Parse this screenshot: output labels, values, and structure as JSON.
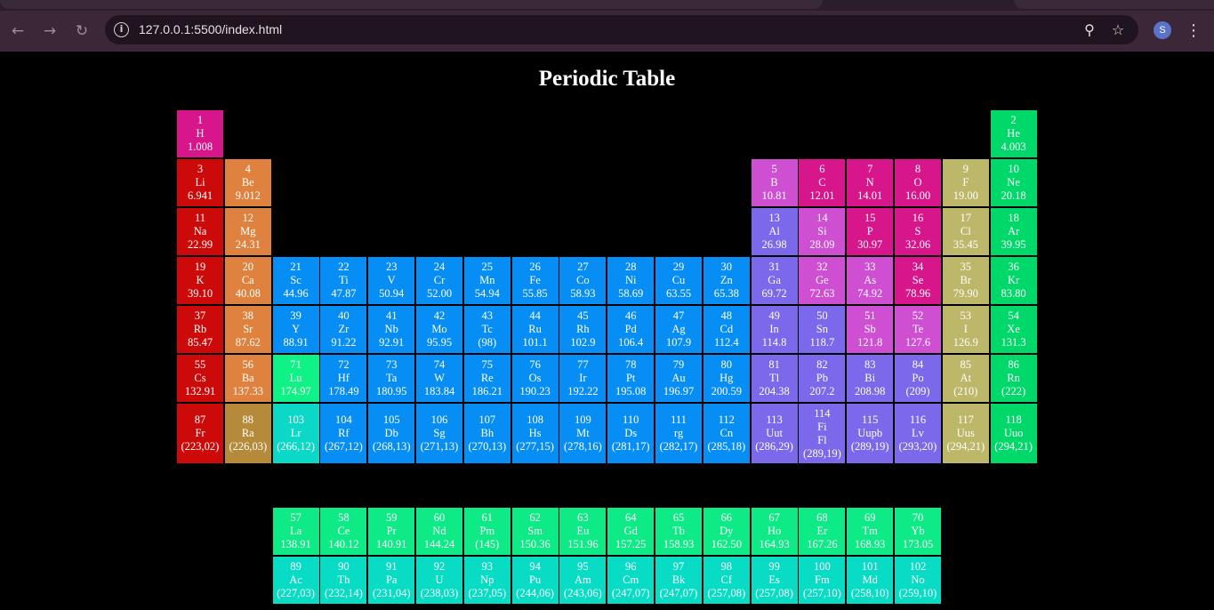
{
  "browser": {
    "url": "127.0.0.1:5500/index.html",
    "avatar_letter": "S",
    "icons": {
      "back": "back-arrow-icon",
      "forward": "forward-arrow-icon",
      "reload": "reload-icon",
      "site_info": "site-info-icon",
      "zoom": "zoom-icon",
      "bookmark": "bookmark-star-icon",
      "menu": "kebab-menu-icon"
    }
  },
  "page": {
    "title": "Periodic Table"
  },
  "colors": {
    "hydrogen": "#d6168a",
    "alkali": "#cc0a0a",
    "alkaline": "#df8240",
    "radium": "#b58a3a",
    "transition": "#078ef5",
    "lanthanide": "#0dea86",
    "actinide": "#08dcc4",
    "lutetium": "#0ff286",
    "lawrencium": "#0cd8c8",
    "post_transition": "#7b68ea",
    "metalloid": "#cf4fd3",
    "nonmetal": "#d6168a",
    "halogen": "#bdb769",
    "noble": "#00d86a"
  },
  "elements": [
    {
      "n": "1",
      "s": "H",
      "m": "1.008",
      "col": 1,
      "row": 1,
      "cat": "hydrogen"
    },
    {
      "n": "2",
      "s": "He",
      "m": "4.003",
      "col": 18,
      "row": 1,
      "cat": "noble"
    },
    {
      "n": "3",
      "s": "Li",
      "m": "6.941",
      "col": 1,
      "row": 2,
      "cat": "alkali"
    },
    {
      "n": "4",
      "s": "Be",
      "m": "9.012",
      "col": 2,
      "row": 2,
      "cat": "alkaline"
    },
    {
      "n": "5",
      "s": "B",
      "m": "10.81",
      "col": 13,
      "row": 2,
      "cat": "metalloid"
    },
    {
      "n": "6",
      "s": "C",
      "m": "12.01",
      "col": 14,
      "row": 2,
      "cat": "nonmetal"
    },
    {
      "n": "7",
      "s": "N",
      "m": "14.01",
      "col": 15,
      "row": 2,
      "cat": "nonmetal"
    },
    {
      "n": "8",
      "s": "O",
      "m": "16.00",
      "col": 16,
      "row": 2,
      "cat": "nonmetal"
    },
    {
      "n": "9",
      "s": "F",
      "m": "19.00",
      "col": 17,
      "row": 2,
      "cat": "halogen"
    },
    {
      "n": "10",
      "s": "Ne",
      "m": "20.18",
      "col": 18,
      "row": 2,
      "cat": "noble"
    },
    {
      "n": "11",
      "s": "Na",
      "m": "22.99",
      "col": 1,
      "row": 3,
      "cat": "alkali"
    },
    {
      "n": "12",
      "s": "Mg",
      "m": "24.31",
      "col": 2,
      "row": 3,
      "cat": "alkaline"
    },
    {
      "n": "13",
      "s": "Al",
      "m": "26.98",
      "col": 13,
      "row": 3,
      "cat": "post_transition"
    },
    {
      "n": "14",
      "s": "Si",
      "m": "28.09",
      "col": 14,
      "row": 3,
      "cat": "metalloid"
    },
    {
      "n": "15",
      "s": "P",
      "m": "30.97",
      "col": 15,
      "row": 3,
      "cat": "nonmetal"
    },
    {
      "n": "16",
      "s": "S",
      "m": "32.06",
      "col": 16,
      "row": 3,
      "cat": "nonmetal"
    },
    {
      "n": "17",
      "s": "Cl",
      "m": "35.45",
      "col": 17,
      "row": 3,
      "cat": "halogen"
    },
    {
      "n": "18",
      "s": "Ar",
      "m": "39.95",
      "col": 18,
      "row": 3,
      "cat": "noble"
    },
    {
      "n": "19",
      "s": "K",
      "m": "39.10",
      "col": 1,
      "row": 4,
      "cat": "alkali"
    },
    {
      "n": "20",
      "s": "Ca",
      "m": "40.08",
      "col": 2,
      "row": 4,
      "cat": "alkaline"
    },
    {
      "n": "21",
      "s": "Sc",
      "m": "44.96",
      "col": 3,
      "row": 4,
      "cat": "transition"
    },
    {
      "n": "22",
      "s": "Ti",
      "m": "47.87",
      "col": 4,
      "row": 4,
      "cat": "transition"
    },
    {
      "n": "23",
      "s": "V",
      "m": "50.94",
      "col": 5,
      "row": 4,
      "cat": "transition"
    },
    {
      "n": "24",
      "s": "Cr",
      "m": "52.00",
      "col": 6,
      "row": 4,
      "cat": "transition"
    },
    {
      "n": "25",
      "s": "Mn",
      "m": "54.94",
      "col": 7,
      "row": 4,
      "cat": "transition"
    },
    {
      "n": "26",
      "s": "Fe",
      "m": "55.85",
      "col": 8,
      "row": 4,
      "cat": "transition"
    },
    {
      "n": "27",
      "s": "Co",
      "m": "58.93",
      "col": 9,
      "row": 4,
      "cat": "transition"
    },
    {
      "n": "28",
      "s": "Ni",
      "m": "58.69",
      "col": 10,
      "row": 4,
      "cat": "transition"
    },
    {
      "n": "29",
      "s": "Cu",
      "m": "63.55",
      "col": 11,
      "row": 4,
      "cat": "transition"
    },
    {
      "n": "30",
      "s": "Zn",
      "m": "65.38",
      "col": 12,
      "row": 4,
      "cat": "transition"
    },
    {
      "n": "31",
      "s": "Ga",
      "m": "69.72",
      "col": 13,
      "row": 4,
      "cat": "post_transition"
    },
    {
      "n": "32",
      "s": "Ge",
      "m": "72.63",
      "col": 14,
      "row": 4,
      "cat": "metalloid"
    },
    {
      "n": "33",
      "s": "As",
      "m": "74.92",
      "col": 15,
      "row": 4,
      "cat": "metalloid"
    },
    {
      "n": "34",
      "s": "Se",
      "m": "78.96",
      "col": 16,
      "row": 4,
      "cat": "nonmetal"
    },
    {
      "n": "35",
      "s": "Br",
      "m": "79.90",
      "col": 17,
      "row": 4,
      "cat": "halogen"
    },
    {
      "n": "36",
      "s": "Kr",
      "m": "83.80",
      "col": 18,
      "row": 4,
      "cat": "noble"
    },
    {
      "n": "37",
      "s": "Rb",
      "m": "85.47",
      "col": 1,
      "row": 5,
      "cat": "alkali"
    },
    {
      "n": "38",
      "s": "Sr",
      "m": "87.62",
      "col": 2,
      "row": 5,
      "cat": "alkaline"
    },
    {
      "n": "39",
      "s": "Y",
      "m": "88.91",
      "col": 3,
      "row": 5,
      "cat": "transition"
    },
    {
      "n": "40",
      "s": "Zr",
      "m": "91.22",
      "col": 4,
      "row": 5,
      "cat": "transition"
    },
    {
      "n": "41",
      "s": "Nb",
      "m": "92.91",
      "col": 5,
      "row": 5,
      "cat": "transition"
    },
    {
      "n": "42",
      "s": "Mo",
      "m": "95.95",
      "col": 6,
      "row": 5,
      "cat": "transition"
    },
    {
      "n": "43",
      "s": "Tc",
      "m": "(98)",
      "col": 7,
      "row": 5,
      "cat": "transition"
    },
    {
      "n": "44",
      "s": "Ru",
      "m": "101.1",
      "col": 8,
      "row": 5,
      "cat": "transition"
    },
    {
      "n": "45",
      "s": "Rh",
      "m": "102.9",
      "col": 9,
      "row": 5,
      "cat": "transition"
    },
    {
      "n": "46",
      "s": "Pd",
      "m": "106.4",
      "col": 10,
      "row": 5,
      "cat": "transition"
    },
    {
      "n": "47",
      "s": "Ag",
      "m": "107.9",
      "col": 11,
      "row": 5,
      "cat": "transition"
    },
    {
      "n": "48",
      "s": "Cd",
      "m": "112.4",
      "col": 12,
      "row": 5,
      "cat": "transition"
    },
    {
      "n": "49",
      "s": "In",
      "m": "114.8",
      "col": 13,
      "row": 5,
      "cat": "post_transition"
    },
    {
      "n": "50",
      "s": "Sn",
      "m": "118.7",
      "col": 14,
      "row": 5,
      "cat": "post_transition"
    },
    {
      "n": "51",
      "s": "Sb",
      "m": "121.8",
      "col": 15,
      "row": 5,
      "cat": "metalloid"
    },
    {
      "n": "52",
      "s": "Te",
      "m": "127.6",
      "col": 16,
      "row": 5,
      "cat": "metalloid"
    },
    {
      "n": "53",
      "s": "I",
      "m": "126.9",
      "col": 17,
      "row": 5,
      "cat": "halogen"
    },
    {
      "n": "54",
      "s": "Xe",
      "m": "131.3",
      "col": 18,
      "row": 5,
      "cat": "noble"
    },
    {
      "n": "55",
      "s": "Cs",
      "m": "132.91",
      "col": 1,
      "row": 6,
      "cat": "alkali"
    },
    {
      "n": "56",
      "s": "Ba",
      "m": "137.33",
      "col": 2,
      "row": 6,
      "cat": "alkaline"
    },
    {
      "n": "71",
      "s": "Lu",
      "m": "174.97",
      "col": 3,
      "row": 6,
      "cat": "lutetium"
    },
    {
      "n": "72",
      "s": "Hf",
      "m": "178.49",
      "col": 4,
      "row": 6,
      "cat": "transition"
    },
    {
      "n": "73",
      "s": "Ta",
      "m": "180.95",
      "col": 5,
      "row": 6,
      "cat": "transition"
    },
    {
      "n": "74",
      "s": "W",
      "m": "183.84",
      "col": 6,
      "row": 6,
      "cat": "transition"
    },
    {
      "n": "75",
      "s": "Re",
      "m": "186.21",
      "col": 7,
      "row": 6,
      "cat": "transition"
    },
    {
      "n": "76",
      "s": "Os",
      "m": "190.23",
      "col": 8,
      "row": 6,
      "cat": "transition"
    },
    {
      "n": "77",
      "s": "Ir",
      "m": "192.22",
      "col": 9,
      "row": 6,
      "cat": "transition"
    },
    {
      "n": "78",
      "s": "Pt",
      "m": "195.08",
      "col": 10,
      "row": 6,
      "cat": "transition"
    },
    {
      "n": "79",
      "s": "Au",
      "m": "196.97",
      "col": 11,
      "row": 6,
      "cat": "transition"
    },
    {
      "n": "80",
      "s": "Hg",
      "m": "200.59",
      "col": 12,
      "row": 6,
      "cat": "transition"
    },
    {
      "n": "81",
      "s": "Tl",
      "m": "204.38",
      "col": 13,
      "row": 6,
      "cat": "post_transition"
    },
    {
      "n": "82",
      "s": "Pb",
      "m": "207.2",
      "col": 14,
      "row": 6,
      "cat": "post_transition"
    },
    {
      "n": "83",
      "s": "Bi",
      "m": "208.98",
      "col": 15,
      "row": 6,
      "cat": "post_transition"
    },
    {
      "n": "84",
      "s": "Po",
      "m": "(209)",
      "col": 16,
      "row": 6,
      "cat": "post_transition"
    },
    {
      "n": "85",
      "s": "At",
      "m": "(210)",
      "col": 17,
      "row": 6,
      "cat": "halogen"
    },
    {
      "n": "86",
      "s": "Rn",
      "m": "(222)",
      "col": 18,
      "row": 6,
      "cat": "noble"
    },
    {
      "n": "87",
      "s": "Fr",
      "m": "(223,02)",
      "col": 1,
      "row": 7,
      "cat": "alkali"
    },
    {
      "n": "88",
      "s": "Ra",
      "m": "(226,03)",
      "col": 2,
      "row": 7,
      "cat": "radium"
    },
    {
      "n": "103",
      "s": "Lr",
      "m": "(266,12)",
      "col": 3,
      "row": 7,
      "cat": "lawrencium"
    },
    {
      "n": "104",
      "s": "Rf",
      "m": "(267,12)",
      "col": 4,
      "row": 7,
      "cat": "transition"
    },
    {
      "n": "105",
      "s": "Db",
      "m": "(268,13)",
      "col": 5,
      "row": 7,
      "cat": "transition"
    },
    {
      "n": "106",
      "s": "Sg",
      "m": "(271,13)",
      "col": 6,
      "row": 7,
      "cat": "transition"
    },
    {
      "n": "107",
      "s": "Bh",
      "m": "(270,13)",
      "col": 7,
      "row": 7,
      "cat": "transition"
    },
    {
      "n": "108",
      "s": "Hs",
      "m": "(277,15)",
      "col": 8,
      "row": 7,
      "cat": "transition"
    },
    {
      "n": "109",
      "s": "Mt",
      "m": "(278,16)",
      "col": 9,
      "row": 7,
      "cat": "transition"
    },
    {
      "n": "110",
      "s": "Ds",
      "m": "(281,17)",
      "col": 10,
      "row": 7,
      "cat": "transition"
    },
    {
      "n": "111",
      "s": "rg",
      "m": "(282,17)",
      "col": 11,
      "row": 7,
      "cat": "transition"
    },
    {
      "n": "112",
      "s": "Cn",
      "m": "(285,18)",
      "col": 12,
      "row": 7,
      "cat": "transition"
    },
    {
      "n": "113",
      "s": "Uut",
      "m": "(286,29)",
      "col": 13,
      "row": 7,
      "cat": "post_transition"
    },
    {
      "n": "114",
      "s": "Fi\nFl",
      "m": "(289,19)",
      "col": 14,
      "row": 7,
      "cat": "post_transition"
    },
    {
      "n": "115",
      "s": "Uupb",
      "m": "(289,19)",
      "col": 15,
      "row": 7,
      "cat": "post_transition"
    },
    {
      "n": "116",
      "s": "Lv",
      "m": "(293,20)",
      "col": 16,
      "row": 7,
      "cat": "post_transition"
    },
    {
      "n": "117",
      "s": "Uus",
      "m": "(294,21)",
      "col": 17,
      "row": 7,
      "cat": "halogen"
    },
    {
      "n": "118",
      "s": "Uuo",
      "m": "(294,21)",
      "col": 18,
      "row": 7,
      "cat": "noble"
    },
    {
      "n": "57",
      "s": "La",
      "m": "138.91",
      "col": 3,
      "row": 9,
      "cat": "lanthanide"
    },
    {
      "n": "58",
      "s": "Ce",
      "m": "140.12",
      "col": 4,
      "row": 9,
      "cat": "lanthanide"
    },
    {
      "n": "59",
      "s": "Pr",
      "m": "140.91",
      "col": 5,
      "row": 9,
      "cat": "lanthanide"
    },
    {
      "n": "60",
      "s": "Nd",
      "m": "144.24",
      "col": 6,
      "row": 9,
      "cat": "lanthanide"
    },
    {
      "n": "61",
      "s": "Pm",
      "m": "(145)",
      "col": 7,
      "row": 9,
      "cat": "lanthanide"
    },
    {
      "n": "62",
      "s": "Sm",
      "m": "150.36",
      "col": 8,
      "row": 9,
      "cat": "lanthanide"
    },
    {
      "n": "63",
      "s": "Eu",
      "m": "151.96",
      "col": 9,
      "row": 9,
      "cat": "lanthanide"
    },
    {
      "n": "64",
      "s": "Gd",
      "m": "157.25",
      "col": 10,
      "row": 9,
      "cat": "lanthanide"
    },
    {
      "n": "65",
      "s": "Tb",
      "m": "158.93",
      "col": 11,
      "row": 9,
      "cat": "lanthanide"
    },
    {
      "n": "66",
      "s": "Dy",
      "m": "162.50",
      "col": 12,
      "row": 9,
      "cat": "lanthanide"
    },
    {
      "n": "67",
      "s": "Ho",
      "m": "164.93",
      "col": 13,
      "row": 9,
      "cat": "lanthanide"
    },
    {
      "n": "68",
      "s": "Er",
      "m": "167.26",
      "col": 14,
      "row": 9,
      "cat": "lanthanide"
    },
    {
      "n": "69",
      "s": "Tm",
      "m": "168.93",
      "col": 15,
      "row": 9,
      "cat": "lanthanide"
    },
    {
      "n": "70",
      "s": "Yb",
      "m": "173.05",
      "col": 16,
      "row": 9,
      "cat": "lanthanide"
    },
    {
      "n": "89",
      "s": "Ac",
      "m": "(227,03)",
      "col": 3,
      "row": 10,
      "cat": "actinide"
    },
    {
      "n": "90",
      "s": "Th",
      "m": "(232,14)",
      "col": 4,
      "row": 10,
      "cat": "actinide"
    },
    {
      "n": "91",
      "s": "Pa",
      "m": "(231,04)",
      "col": 5,
      "row": 10,
      "cat": "actinide"
    },
    {
      "n": "92",
      "s": "U",
      "m": "(238,03)",
      "col": 6,
      "row": 10,
      "cat": "actinide"
    },
    {
      "n": "93",
      "s": "Np",
      "m": "(237,05)",
      "col": 7,
      "row": 10,
      "cat": "actinide"
    },
    {
      "n": "94",
      "s": "Pu",
      "m": "(244,06)",
      "col": 8,
      "row": 10,
      "cat": "actinide"
    },
    {
      "n": "95",
      "s": "Am",
      "m": "(243,06)",
      "col": 9,
      "row": 10,
      "cat": "actinide"
    },
    {
      "n": "96",
      "s": "Cm",
      "m": "(247,07)",
      "col": 10,
      "row": 10,
      "cat": "actinide"
    },
    {
      "n": "97",
      "s": "Bk",
      "m": "(247,07)",
      "col": 11,
      "row": 10,
      "cat": "actinide"
    },
    {
      "n": "98",
      "s": "Cf",
      "m": "(257,08)",
      "col": 12,
      "row": 10,
      "cat": "actinide"
    },
    {
      "n": "99",
      "s": "Es",
      "m": "(257,08)",
      "col": 13,
      "row": 10,
      "cat": "actinide"
    },
    {
      "n": "100",
      "s": "Fm",
      "m": "(257,10)",
      "col": 14,
      "row": 10,
      "cat": "actinide"
    },
    {
      "n": "101",
      "s": "Md",
      "m": "(258,10)",
      "col": 15,
      "row": 10,
      "cat": "actinide"
    },
    {
      "n": "102",
      "s": "No",
      "m": "(259,10)",
      "col": 16,
      "row": 10,
      "cat": "actinide"
    }
  ]
}
